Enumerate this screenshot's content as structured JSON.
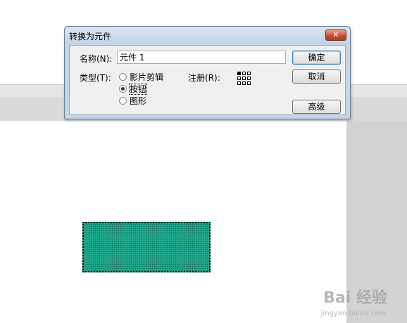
{
  "dialog": {
    "title": "转换为元件",
    "close_glyph": "✕",
    "name_label": "名称(N):",
    "name_value": "元件 1",
    "type_label": "类型(T):",
    "type_options": [
      {
        "label": "影片剪辑",
        "selected": false
      },
      {
        "label": "按钮",
        "selected": true
      },
      {
        "label": "图形",
        "selected": false
      }
    ],
    "registration_label": "注册(R):",
    "registration_selected": "top-left",
    "buttons": {
      "ok": "确定",
      "cancel": "取消",
      "advanced": "高级"
    }
  },
  "stage": {
    "shape_fill_color": "#1ea98a"
  },
  "watermark": {
    "brand": "Bai 经验",
    "url": "jingyan.baidu.com"
  }
}
